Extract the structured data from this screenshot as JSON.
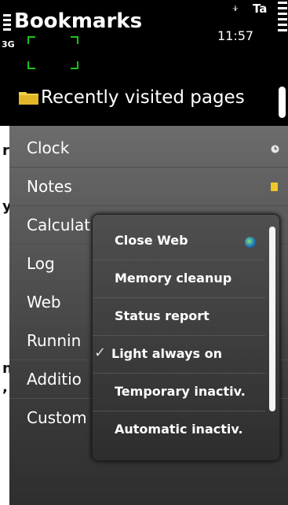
{
  "status_bar": {
    "title": "Bookmarks",
    "network": "3G",
    "time": "11:57",
    "operator": "Ta",
    "usb": "⨨"
  },
  "list": {
    "recent_label": "Recently visited pages"
  },
  "background_fragments": [
    "r",
    "y",
    "n",
    ","
  ],
  "menu": {
    "items": [
      {
        "label": "Clock"
      },
      {
        "label": "Notes"
      },
      {
        "label": "Calculat"
      },
      {
        "label": "Log"
      },
      {
        "label": "Web"
      },
      {
        "label": "Runnin"
      },
      {
        "label": "Additio"
      },
      {
        "label": "Custom"
      }
    ]
  },
  "submenu": {
    "items": [
      {
        "label": "Close Web"
      },
      {
        "label": "Memory cleanup"
      },
      {
        "label": "Status report"
      },
      {
        "label": "Light always on",
        "checked": true
      },
      {
        "label": "Temporary inactiv."
      },
      {
        "label": "Automatic inactiv."
      }
    ],
    "check_glyph": "✓"
  },
  "colors": {
    "menu_top": "#6c6c6c",
    "menu_bottom": "#2e2e2e",
    "folder": "#f2d24a",
    "accent_green": "#19c419"
  }
}
